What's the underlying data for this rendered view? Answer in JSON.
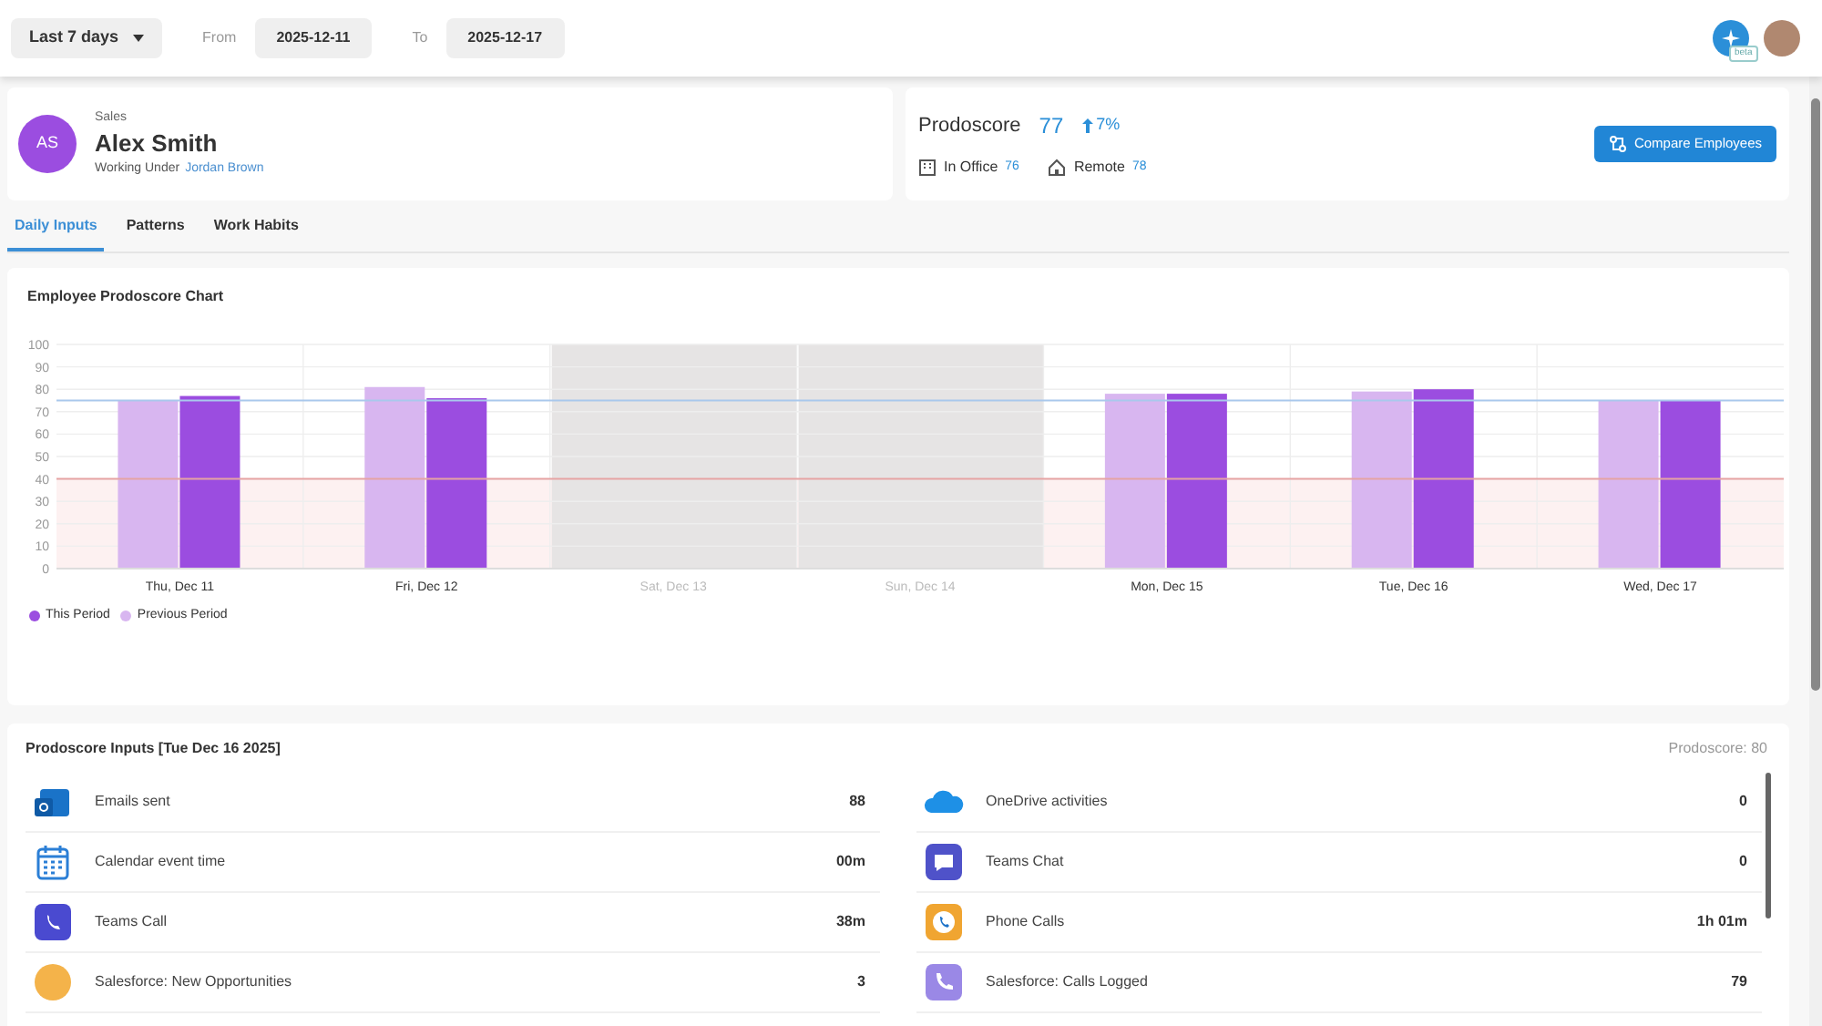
{
  "filters": {
    "range": "Last 7 days",
    "from_label": "From",
    "from": "2025-12-11",
    "to_label": "To",
    "to": "2025-12-17"
  },
  "top_right": {
    "assistant_badge": "beta"
  },
  "employee": {
    "initials": "AS",
    "department": "Sales",
    "name": "Alex Smith",
    "manager_label": "Working Under",
    "manager": "Jordan Brown"
  },
  "score": {
    "label": "Prodoscore",
    "value": "77",
    "change": "7%",
    "in_office_label": "In Office",
    "in_office": "76",
    "remote_label": "Remote",
    "remote": "78",
    "compare_button": "Compare Employees"
  },
  "tabs": [
    {
      "label": "Daily Inputs",
      "selected": true
    },
    {
      "label": "Patterns",
      "selected": false
    },
    {
      "label": "Work Habits",
      "selected": false
    }
  ],
  "chart": {
    "chart_data": {
      "type": "bar",
      "title": "Employee Prodoscore Chart",
      "categories": [
        "Thu, Dec 11",
        "Fri, Dec 12",
        "Sat, Dec 13",
        "Sun, Dec 14",
        "Mon, Dec 15",
        "Tue, Dec 16",
        "Wed, Dec 17"
      ],
      "ylim": [
        0,
        100
      ],
      "yticks": [
        0,
        10,
        20,
        30,
        40,
        50,
        60,
        70,
        80,
        90,
        100
      ],
      "series": [
        {
          "name": "This Period",
          "color": "#9b4de0",
          "values": [
            77,
            76,
            null,
            null,
            78,
            80,
            75
          ]
        },
        {
          "name": "Previous Period",
          "color": "#d8b6f0",
          "values": [
            75,
            81,
            null,
            null,
            78,
            79,
            75
          ]
        }
      ],
      "grid": true,
      "legend": true,
      "bands": [
        {
          "axis": "y",
          "from": 0,
          "to": 40,
          "color": "#fdf1f1"
        }
      ],
      "ref_lines": [
        {
          "axis": "y",
          "value": 75,
          "color": "#a9c8ec"
        },
        {
          "axis": "y",
          "value": 40,
          "color": "#e6a3a3"
        }
      ]
    }
  },
  "inputs": {
    "title": "Prodoscore Inputs [Tue Dec 16 2025]",
    "score": "Prodoscore: 80",
    "left": [
      {
        "kind": "outlook",
        "label": "Emails sent",
        "value": "88"
      },
      {
        "kind": "calendar",
        "label": "Calendar event time",
        "value": "00m"
      },
      {
        "kind": "teams-call",
        "label": "Teams Call",
        "value": "38m"
      },
      {
        "kind": "salesforce-opportunity",
        "label": "Salesforce: New Opportunities",
        "value": "3"
      }
    ],
    "right": [
      {
        "kind": "onedrive",
        "label": "OneDrive activities",
        "value": "0"
      },
      {
        "kind": "teams-chat",
        "label": "Teams Chat",
        "value": "0"
      },
      {
        "kind": "phone",
        "label": "Phone Calls",
        "value": "1h 01m"
      },
      {
        "kind": "salesforce-call",
        "label": "Salesforce: Calls Logged",
        "value": "79"
      }
    ]
  }
}
